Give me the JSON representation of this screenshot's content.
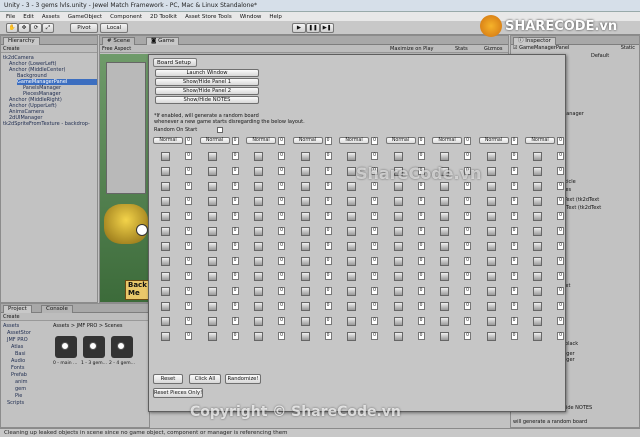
{
  "window": {
    "title": "Unity - 3 - 3 gems lvls.unity - Jewel Match Framework - PC, Mac & Linux Standalone*"
  },
  "menu": [
    "File",
    "Edit",
    "Assets",
    "GameObject",
    "Component",
    "2D Toolkit",
    "Asset Store Tools",
    "Window",
    "Help"
  ],
  "toolbar": {
    "pivot_label": "Pivot",
    "local_label": "Local"
  },
  "hierarchy": {
    "tab": "Hierarchy",
    "create_label": "Create",
    "items": [
      "tk2dCamera",
      "Anchor (LowerLeft)",
      "Anchor (MiddleCenter)",
      "Background",
      "GameManagerPanel",
      "PanelsManager",
      "PiecesManager",
      "Anchor (MiddleRight)",
      "Anchor (UpperLeft)",
      "AnimsCamera",
      "2dUIManager",
      "tk2dSpriteFromTexture - backdrop-"
    ]
  },
  "scene": {
    "scene_tab": "Scene",
    "game_tab": "Game",
    "aspect_label": "Free Aspect",
    "maximize_label": "Maximize on Play",
    "stats_label": "Stats",
    "gizmos_label": "Gizmos",
    "game_text_1": "Back",
    "game_text_2": "Me"
  },
  "inspector": {
    "tab": "Inspector",
    "object_name": "GameManagerPanel",
    "static_label": "Static",
    "layer_label": "ayer",
    "layer_value": "Default",
    "rows": [
      "(Script)",
      "GameManager",
      "20",
      "cks particle",
      "ateMoves",
      "bScoreText (tk2dText",
      "bMovesText (tk2dText",
      "bmbtxt",
      "renUIText",
      "-Board black",
      "esManager",
      "esManager",
      "(Script)",
      "ndow",
      "Panel 1",
      "Panel 2",
      "Show/Hide NOTES"
    ],
    "bottom_text": "will generate a random board"
  },
  "project": {
    "tab": "Project",
    "console_tab": "Console",
    "create_label": "Create",
    "path": "Assets > JMF PRO > Scenes",
    "tree": [
      "Assets",
      "AssetStor",
      "JMF PRO",
      "Atlas",
      "Basi",
      "Audio",
      "Fonts",
      "Prefab",
      "anim",
      "gem",
      "Pie",
      "Scripts"
    ],
    "scenes": [
      "0 - main ...",
      "1 - 3 gem...",
      "2 - 4 gem..."
    ]
  },
  "dialog": {
    "tab": "Board Setup",
    "buttons": [
      "Launch Window",
      "Show/Hide Panel 1",
      "Show/Hide Panel 2",
      "Show/Hide NOTES"
    ],
    "info_line1": "*If enabled, will generate a random board",
    "info_line2": "whenever a new game starts disregarding the below layout.",
    "random_label": "Random On Start",
    "cell_label": "Normal",
    "cell_value": "0",
    "reset_label": "Reset",
    "click_all_label": "Click All",
    "randomize_label": "Randomize!",
    "reset_pieces_label": "Reset Pieces Only!"
  },
  "status": {
    "text": "Cleaning up leaked objects in scene since no game object, component or manager is referencing them"
  },
  "watermark": {
    "logo": "SHARECODE.vn",
    "center": "ShareCode.vn",
    "bottom": "Copyright © ShareCode.vn"
  }
}
